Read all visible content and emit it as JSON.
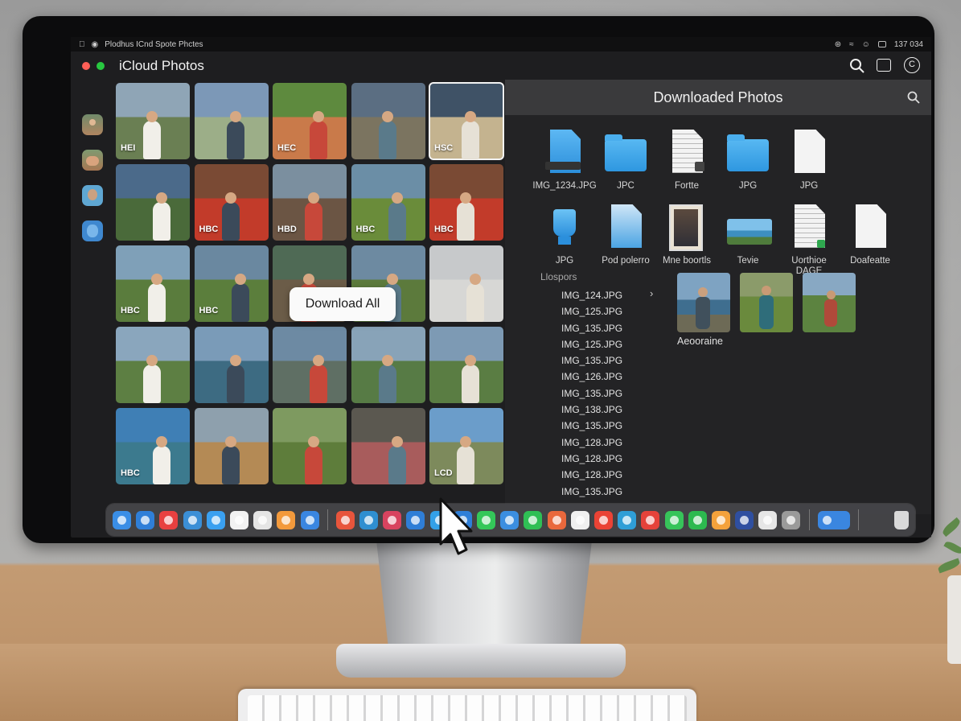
{
  "menubar": {
    "title": "Plodhus ICnd Spote Phctes",
    "clock": "137 034"
  },
  "app": {
    "title": "iCloud Photos",
    "window_dots": [
      "#ff5f57",
      "#28c840"
    ]
  },
  "sidebar": {
    "items": [
      {
        "icon": "person-photo-icon"
      },
      {
        "icon": "group-photo-icon"
      },
      {
        "icon": "portrait-icon"
      },
      {
        "icon": "pumpkin-icon"
      }
    ]
  },
  "grid": {
    "thumbs": [
      {
        "label": "HEI",
        "colors": [
          "#8fa5b6",
          "#6a7f53"
        ]
      },
      {
        "label": "",
        "colors": [
          "#7c98b7",
          "#9cae88"
        ]
      },
      {
        "label": "HEC",
        "colors": [
          "#5e8a3e",
          "#c97a4a"
        ]
      },
      {
        "label": "",
        "colors": [
          "#5b6e82",
          "#7b7460"
        ]
      },
      {
        "label": "HSC",
        "colors": [
          "#3f5266",
          "#c4b38f"
        ],
        "selected": true
      },
      {
        "label": "",
        "colors": [
          "#4b6a8a",
          "#4a6a3a"
        ]
      },
      {
        "label": "HBC",
        "colors": [
          "#7a4a34",
          "#c23b2a"
        ]
      },
      {
        "label": "HBD",
        "colors": [
          "#7b8f9f",
          "#6b5544"
        ]
      },
      {
        "label": "HBC",
        "colors": [
          "#6b8ea6",
          "#6a8c3a"
        ]
      },
      {
        "label": "HBC",
        "colors": [
          "#7a4a34",
          "#c23b2a"
        ]
      },
      {
        "label": "HBC",
        "colors": [
          "#7fa0b8",
          "#5a7c3d"
        ]
      },
      {
        "label": "HBC",
        "colors": [
          "#6a88a0",
          "#5b7e3c"
        ]
      },
      {
        "label": "",
        "colors": [
          "#4f6a55",
          "#6b5c48"
        ]
      },
      {
        "label": "",
        "colors": [
          "#6d8aa1",
          "#5c7a3c"
        ]
      },
      {
        "label": "",
        "colors": [
          "#c7c9cb",
          "#d7d7d5"
        ]
      },
      {
        "label": "",
        "colors": [
          "#8aa6bd",
          "#5d7f43"
        ]
      },
      {
        "label": "",
        "colors": [
          "#7a9bb8",
          "#3d6b82"
        ]
      },
      {
        "label": "",
        "colors": [
          "#6d8aa3",
          "#5f6f64"
        ]
      },
      {
        "label": "",
        "colors": [
          "#88a3b8",
          "#577b45"
        ]
      },
      {
        "label": "",
        "colors": [
          "#7d9ab4",
          "#5a7d43"
        ]
      },
      {
        "label": "HBC",
        "colors": [
          "#3f7fb5",
          "#3c7a8e"
        ]
      },
      {
        "label": "",
        "colors": [
          "#8ea0ad",
          "#b48a55"
        ]
      },
      {
        "label": "",
        "colors": [
          "#7e9a60",
          "#5e7d3b"
        ]
      },
      {
        "label": "",
        "colors": [
          "#5b5850",
          "#a85c5c"
        ]
      },
      {
        "label": "LCD",
        "colors": [
          "#6b9dca",
          "#7d8a5c"
        ]
      }
    ],
    "download_all_label": "Download All"
  },
  "panel": {
    "title": "Downloaded Photos",
    "files": [
      {
        "name": "IMG_1234.JPG",
        "type": "blue-doc"
      },
      {
        "name": "JPC",
        "type": "folder"
      },
      {
        "name": "Fortte",
        "type": "text-doc"
      },
      {
        "name": "JPG",
        "type": "folder"
      },
      {
        "name": "JPG",
        "type": "blank-doc"
      },
      {
        "name": "",
        "type": "empty"
      },
      {
        "name": "JPG",
        "type": "blue-cup"
      },
      {
        "name": "Pod polerro",
        "type": "preview-doc"
      },
      {
        "name": "Mne boortls",
        "type": "photo-doc"
      },
      {
        "name": "Tevie",
        "type": "landscape"
      },
      {
        "name": "Uorthioe DAGE",
        "type": "sheet-doc"
      },
      {
        "name": "Doafeatte",
        "type": "blank-doc"
      }
    ],
    "list_label": "Llospors",
    "list_items": [
      "IMG_124.JPG",
      "IMG_125.JPG",
      "IMG_135.JPG",
      "IMG_125.JPG",
      "IMG_135.JPG",
      "IMG_126.JPG",
      "IMG_135.JPG",
      "IMG_138.JPG",
      "IMG_135.JPG",
      "IMG_128.JPG",
      "IMG_128.JPG",
      "IMG_128.JPG",
      "IMG_135.JPG"
    ],
    "preview_label": "Aeooraine"
  },
  "dock": {
    "apps": [
      {
        "name": "finder-icon",
        "color": "#3a8ee6"
      },
      {
        "name": "xcode-icon",
        "color": "#2f7fd8"
      },
      {
        "name": "record-icon",
        "color": "#e84040"
      },
      {
        "name": "preview-icon",
        "color": "#3b8fd6"
      },
      {
        "name": "files-icon",
        "color": "#3aa0f0"
      },
      {
        "name": "chat-icon",
        "color": "#f2f2f2"
      },
      {
        "name": "drive-icon",
        "color": "#e5e5e5"
      },
      {
        "name": "calendar-icon",
        "color": "#f39a3c"
      },
      {
        "name": "compass-icon",
        "color": "#3a86e0"
      },
      {
        "name": "separator"
      },
      {
        "name": "app-red-icon",
        "color": "#e8553c"
      },
      {
        "name": "weather-icon",
        "color": "#2f8fd0"
      },
      {
        "name": "instagram-icon",
        "color": "#d8435f"
      },
      {
        "name": "shield-icon",
        "color": "#2f7ed6"
      },
      {
        "name": "notes-icon",
        "color": "#33a1e8"
      },
      {
        "name": "window-icon",
        "color": "#2f7fd8"
      },
      {
        "name": "messages-icon",
        "color": "#34c759"
      },
      {
        "name": "pen-icon",
        "color": "#3b8ee0"
      },
      {
        "name": "check-icon",
        "color": "#2fbf55"
      },
      {
        "name": "target-icon",
        "color": "#e9683c"
      },
      {
        "name": "gift-icon",
        "color": "#f0f0f0"
      },
      {
        "name": "chrome-icon",
        "color": "#ea4335"
      },
      {
        "name": "refresh-icon",
        "color": "#2f9ed6"
      },
      {
        "name": "settings-red-icon",
        "color": "#e5423a"
      },
      {
        "name": "facetime-icon",
        "color": "#37c45a"
      },
      {
        "name": "maps-icon",
        "color": "#2cb94f"
      },
      {
        "name": "grid-icon",
        "color": "#f4a23b"
      },
      {
        "name": "circle-icon",
        "color": "#2f4fa0"
      },
      {
        "name": "puzzle-icon",
        "color": "#e6e6e6"
      },
      {
        "name": "trash-small-icon",
        "color": "#9a9a9a"
      },
      {
        "name": "separator"
      },
      {
        "name": "terminal-icon",
        "color": "#3a86e0"
      },
      {
        "name": "separator"
      },
      {
        "name": "trash-icon",
        "color": "#d9d9d9"
      }
    ]
  }
}
